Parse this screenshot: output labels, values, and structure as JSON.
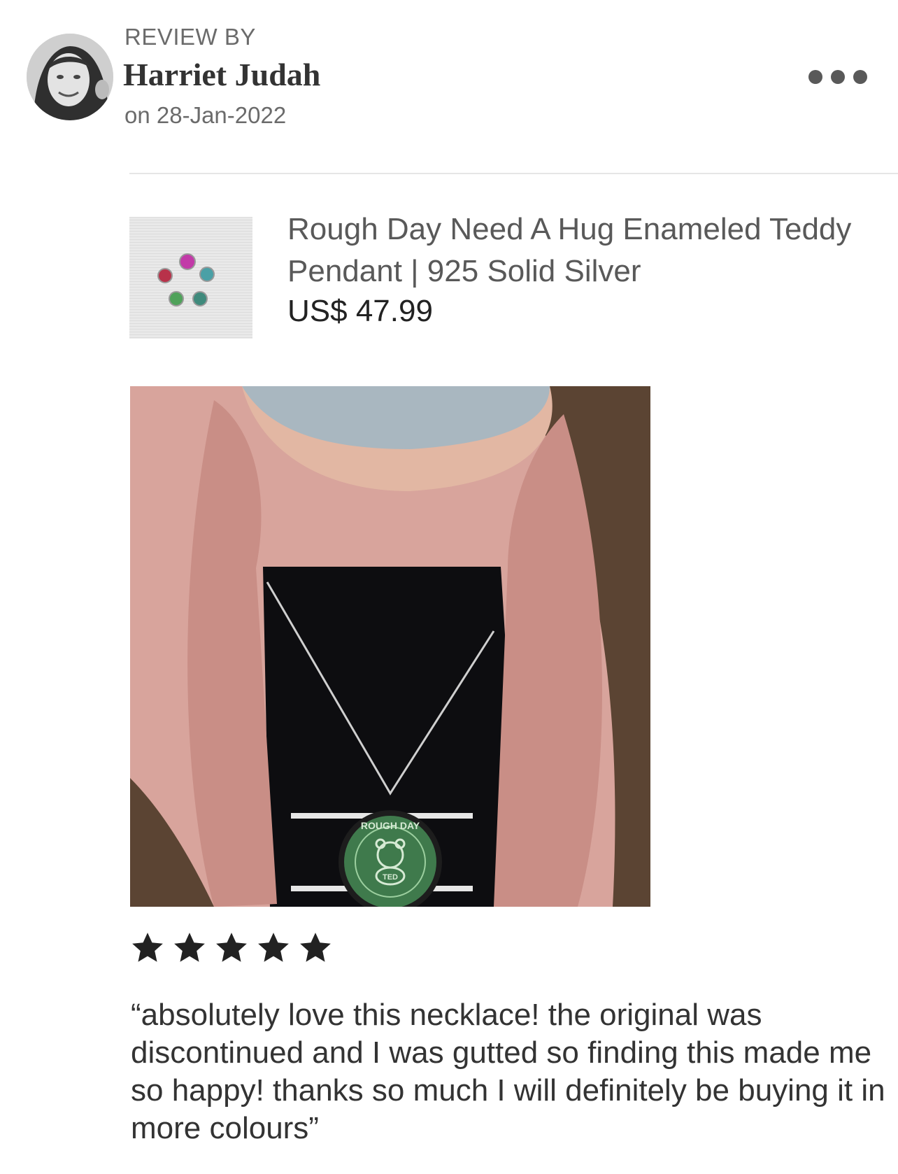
{
  "reviewer": {
    "label": "REVIEW BY",
    "name": "Harriet Judah",
    "date": "on 28-Jan-2022",
    "avatar_icon": "avatar-photo"
  },
  "menu": {
    "icon": "more-dots-icon"
  },
  "product": {
    "title": "Rough Day Need A Hug Enameled Teddy Pendant | 925 Solid Silver",
    "price": "US$ 47.99",
    "thumbnail": "pendant-colors-photo"
  },
  "review": {
    "rating": 5,
    "rating_max": 5,
    "text": "“absolutely love this necklace! the original was discontinued and I was gutted so finding this made me so happy! thanks so much I will definitely be buying it in more colours”",
    "photo": "necklace-worn-photo",
    "pendant_label": "ROUGH DAY",
    "pendant_center_label": "TED"
  },
  "colors": {
    "star": "#222222",
    "muted_text": "#6b6b6b",
    "menu_dots": "#595959",
    "coat": "#d7a39b",
    "pendant_green": "#3f7a4c"
  }
}
